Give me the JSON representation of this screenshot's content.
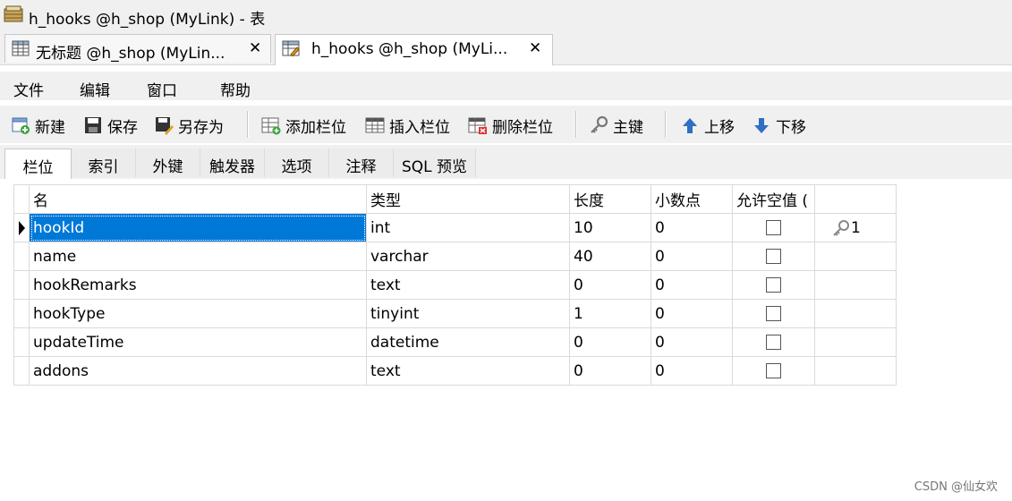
{
  "window": {
    "title": "h_hooks @h_shop (MyLink) - 表"
  },
  "tabs": [
    {
      "label": "无标题 @h_shop (MyLin...",
      "close": "✕"
    },
    {
      "label": "h_hooks @h_shop (MyLi...",
      "close": "✕"
    }
  ],
  "menu": [
    "文件",
    "编辑",
    "窗口",
    "帮助"
  ],
  "toolbar": {
    "new": "新建",
    "save": "保存",
    "save_as": "另存为",
    "add_field": "添加栏位",
    "insert_field": "插入栏位",
    "delete_field": "删除栏位",
    "primary_key": "主键",
    "move_up": "上移",
    "move_down": "下移"
  },
  "subtabs": [
    "栏位",
    "索引",
    "外键",
    "触发器",
    "选项",
    "注释",
    "SQL 预览"
  ],
  "grid": {
    "headers": [
      "名",
      "类型",
      "长度",
      "小数点",
      "允许空值 (",
      ""
    ],
    "rows": [
      {
        "name": "hookId",
        "type": "int",
        "length": "10",
        "decimals": "0",
        "key": "1"
      },
      {
        "name": "name",
        "type": "varchar",
        "length": "40",
        "decimals": "0",
        "key": ""
      },
      {
        "name": "hookRemarks",
        "type": "text",
        "length": "0",
        "decimals": "0",
        "key": ""
      },
      {
        "name": "hookType",
        "type": "tinyint",
        "length": "1",
        "decimals": "0",
        "key": ""
      },
      {
        "name": "updateTime",
        "type": "datetime",
        "length": "0",
        "decimals": "0",
        "key": ""
      },
      {
        "name": "addons",
        "type": "text",
        "length": "0",
        "decimals": "0",
        "key": ""
      }
    ]
  },
  "watermark": "CSDN @仙女欢",
  "colors": {
    "selection": "#0078d7",
    "chrome": "#f0f0f0"
  }
}
